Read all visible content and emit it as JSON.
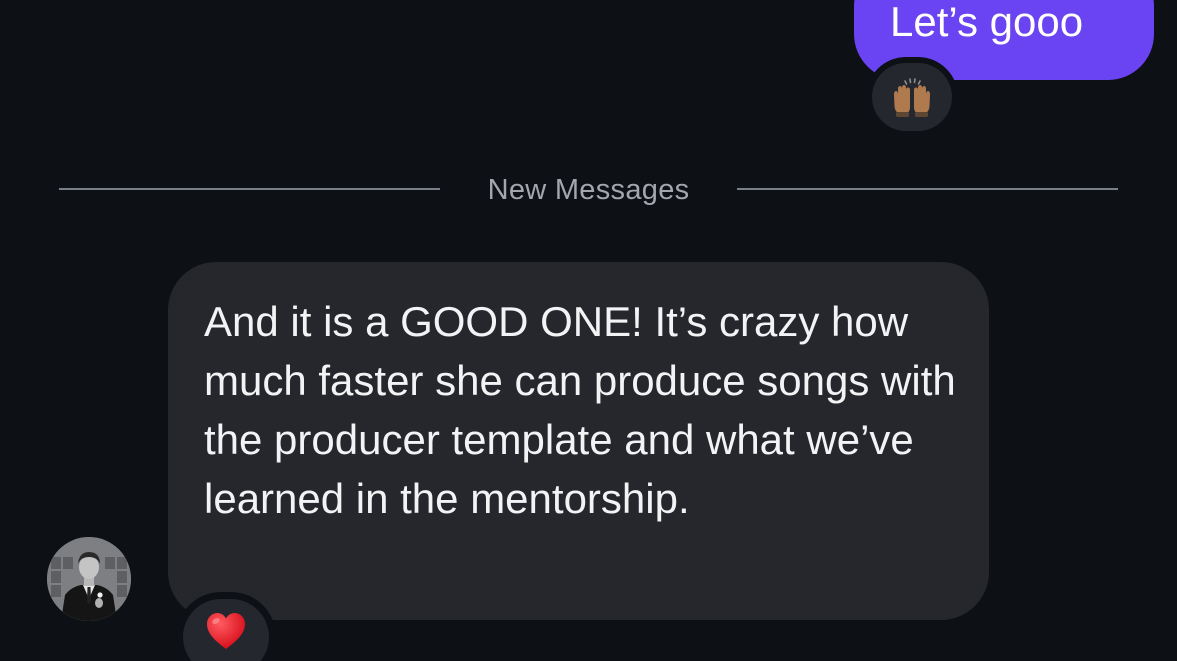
{
  "outgoing_message": {
    "text": "Let’s gooo",
    "bubble_color": "#6a44f2",
    "reaction": "raising-hands-icon"
  },
  "divider": {
    "label": "New Messages"
  },
  "incoming_message": {
    "text": "And it is a GOOD ONE! It’s crazy how much faster she can produce songs with the producer template and what we’ve learned in the mentorship.",
    "bubble_color": "#25272c",
    "reaction": "red-heart-icon"
  },
  "sender": {
    "avatar": "avatar-photo"
  },
  "colors": {
    "background": "#0d1014",
    "heart": "#e0242f"
  }
}
